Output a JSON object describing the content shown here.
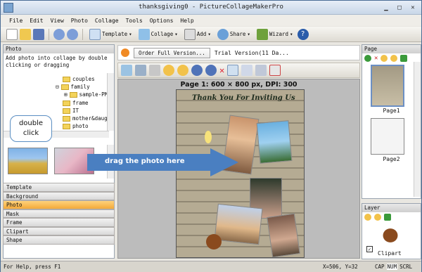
{
  "window": {
    "title": "thanksgiving0 - PictureCollageMakerPro"
  },
  "menu": [
    "File",
    "Edit",
    "View",
    "Photo",
    "Collage",
    "Tools",
    "Options",
    "Help"
  ],
  "toolbar": {
    "template": "Template",
    "collage": "Collage",
    "add": "Add",
    "share": "Share",
    "wizard": "Wizard"
  },
  "photo_panel": {
    "title": "Photo",
    "hint": "Add photo into collage by double clicking or dragging",
    "folders": [
      "couples",
      "family",
      "sample-PM",
      "frame",
      "IT",
      "mother&daugh",
      "photo"
    ],
    "callout": "double click"
  },
  "side_tabs": [
    "Template",
    "Background",
    "Photo",
    "Mask",
    "Frame",
    "Clipart",
    "Shape"
  ],
  "notice": {
    "order_button": "Order Full Version...",
    "trial_text": "Trial Version(11 Da..."
  },
  "canvas": {
    "page_info": "Page 1: 600 × 800 px, DPI: 300",
    "collage_title": "Thank You For Inviting Us",
    "drag_hint": "drag the photo here"
  },
  "pages_panel": {
    "title": "Page",
    "pages": [
      "Page1",
      "Page2"
    ]
  },
  "layer_panel": {
    "title": "Layer",
    "item": "Clipart"
  },
  "status": {
    "help": "For Help, press F1",
    "coords": "X=506, Y=32",
    "indicators": [
      "CAP",
      "NUM",
      "SCRL"
    ]
  },
  "colors": {
    "accent": "#4a7fc1",
    "active_tab": "#f3a93a",
    "arrow": "#4a7fc1"
  }
}
